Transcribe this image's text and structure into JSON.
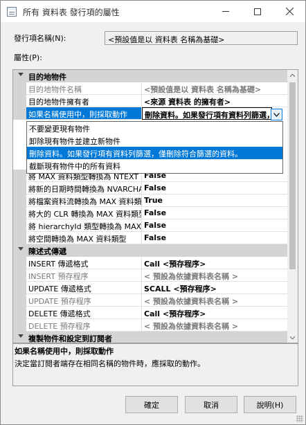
{
  "window": {
    "title": "所有 資料表 發行項的屬性"
  },
  "header": {
    "pub_name_label": "發行項名稱(N):",
    "pub_name_value": "<預設值是以 資料表 名稱為基礎>",
    "props_label": "屬性(P):"
  },
  "grid": {
    "cat_destination": "目的地物件",
    "rows": [
      {
        "name": "目的地物件名稱",
        "value": "<預設值是以 資料表 名稱為基礎>"
      },
      {
        "name": "目的地物件擁有者",
        "value": "<來源 資料表 的擁有者>"
      },
      {
        "name": "如果名稱使用中，則採取動作",
        "value": "刪除資料。如果發行項有資料列篩選，僅刪除符合篩選的資料。"
      },
      {
        "name": "將 MAX 資料類型轉換為 NTEXT 和 IMAGE",
        "value": "False"
      },
      {
        "name": "將新的日期時間轉換為 NVARCHAR",
        "value": "False"
      },
      {
        "name": "將檔案資料流轉換為 MAX 資料類型",
        "value": "True"
      },
      {
        "name": "將大的 CLR 轉換為 MAX 資料類型",
        "value": "False"
      },
      {
        "name": "將 hierarchyId 類型轉換為 MAX 資料類型",
        "value": "False"
      },
      {
        "name": "將空間轉換為 MAX 資料類型",
        "value": "False"
      }
    ],
    "cat_stmt": "陳述式傳遞",
    "stmt_rows": [
      {
        "name": "INSERT 傳遞格式",
        "value": "Call <預存程序>"
      },
      {
        "name": "INSERT 預存程序",
        "value": "< 預設為依據資料表名稱 >"
      },
      {
        "name": "UPDATE 傳遞格式",
        "value": "SCALL <預存程序>"
      },
      {
        "name": "UPDATE 預存程序",
        "value": "< 預設為依據資料表名稱 >"
      },
      {
        "name": "DELETE 傳遞格式",
        "value": "Call <預存程序>"
      },
      {
        "name": "DELETE 預存程序",
        "value": "< 預設為依據資料表名稱 >"
      }
    ],
    "cat_copy": "複製物件和設定到訂閱者"
  },
  "dropdown": {
    "options": [
      "不要變更現有物件",
      "卸除現有物件並建立新物件",
      "刪除資料。如果發行項有資料列篩選，僅刪除符合篩選的資料。",
      "截斷現有物件中的所有資料"
    ],
    "selected_index": 2
  },
  "description": {
    "title": "如果名稱使用中，則採取動作",
    "text": "決定當訂閱者端存在相同名稱的物件時，應採取的動作。"
  },
  "buttons": {
    "ok": "確定",
    "cancel": "取消",
    "help": "說明(H)"
  },
  "colors": {
    "selection": "#0078d7",
    "category_bg": "#d4d4d4",
    "disabled_text": "#7a7a7a"
  }
}
